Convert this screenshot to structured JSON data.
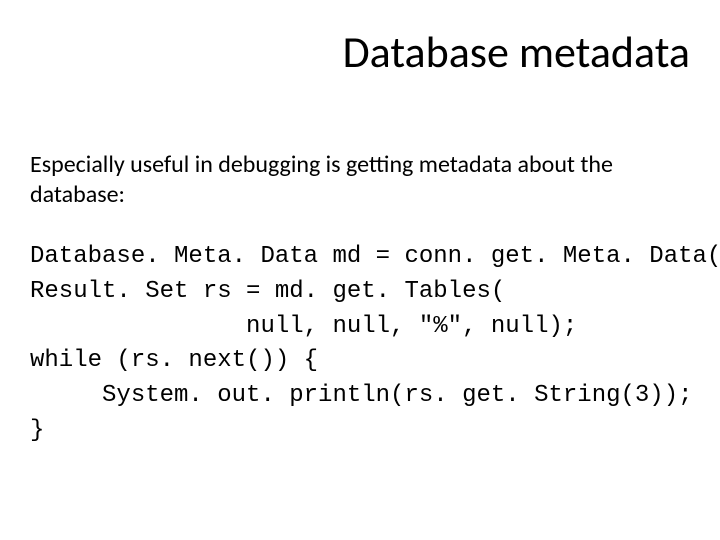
{
  "title": "Database metadata",
  "intro": "Especially useful in debugging is getting metadata about the database:",
  "code_lines": [
    "Database. Meta. Data md = conn. get. Meta. Data();",
    "Result. Set rs = md. get. Tables(",
    "               null, null, \"%\", null);",
    "while (rs. next()) {",
    "     System. out. println(rs. get. String(3));",
    "}"
  ]
}
